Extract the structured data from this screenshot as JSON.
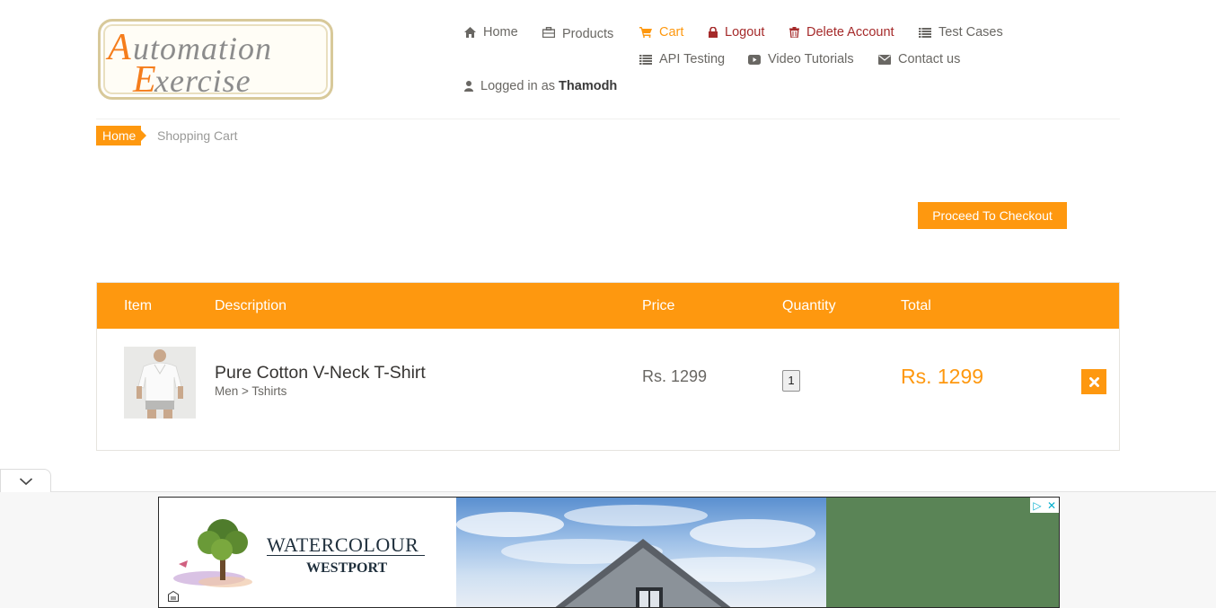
{
  "logo": {
    "text_line1": "Automation",
    "text_line2": "Exercise"
  },
  "nav": {
    "home": "Home",
    "products": "Products",
    "cart": "Cart",
    "logout": "Logout",
    "delete_account": "Delete Account",
    "test_cases": "Test Cases",
    "api_testing": "API Testing",
    "video_tutorials": "Video Tutorials",
    "contact_us": "Contact us",
    "logged_in_prefix": "Logged in as",
    "logged_in_user": "Thamodh"
  },
  "breadcrumb": {
    "home": "Home",
    "current": "Shopping Cart"
  },
  "checkout": {
    "label": "Proceed To Checkout"
  },
  "cart": {
    "headers": {
      "item": "Item",
      "description": "Description",
      "price": "Price",
      "quantity": "Quantity",
      "total": "Total"
    },
    "rows": [
      {
        "name": "Pure Cotton V-Neck T-Shirt",
        "category": "Men > Tshirts",
        "price": "Rs. 1299",
        "quantity": "1",
        "total": "Rs. 1299"
      }
    ]
  },
  "ad": {
    "brand": "WATERCOLOUR",
    "sub": "WESTPORT"
  },
  "colors": {
    "accent": "#fe980f",
    "danger": "#a52a2a",
    "text": "#696763"
  },
  "icons": {
    "home": "home-icon",
    "products": "briefcase-icon",
    "cart": "cart-icon",
    "logout": "lock-icon",
    "delete": "trash-icon",
    "test_cases": "list-icon",
    "api": "list-icon",
    "video": "youtube-icon",
    "contact": "envelope-icon",
    "user": "user-icon",
    "remove": "close-icon"
  }
}
